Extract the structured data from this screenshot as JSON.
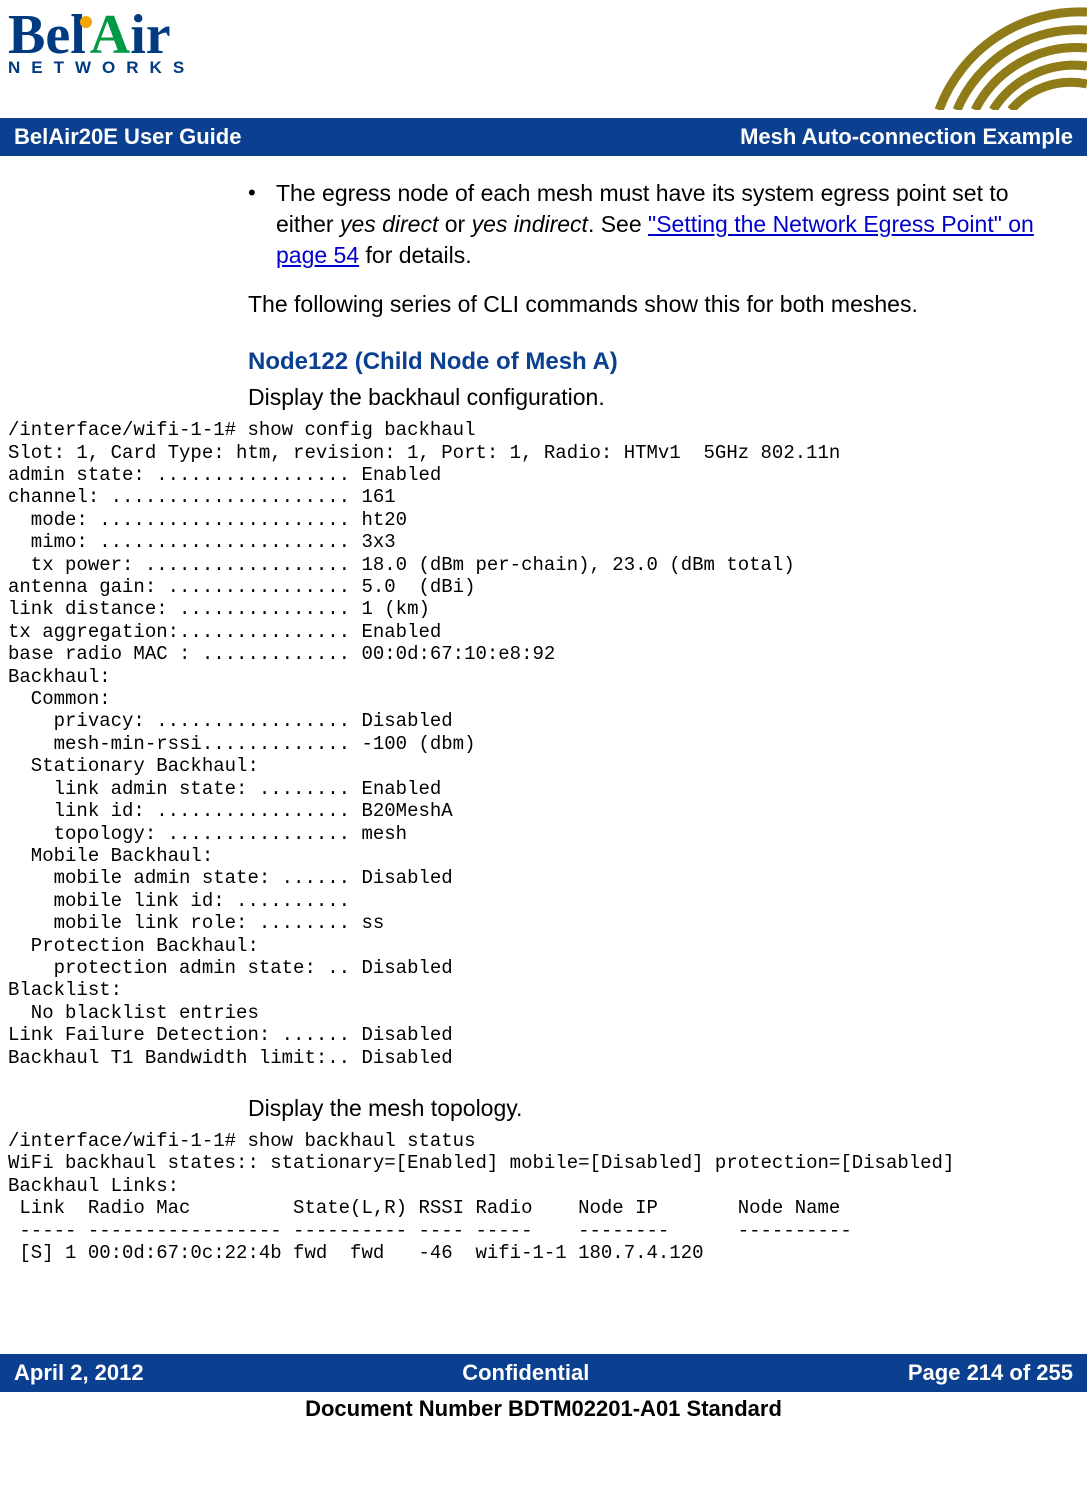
{
  "logo": {
    "bel": "Bel",
    "a": "A",
    "ir": "ir",
    "networks": "NETWORKS"
  },
  "header": {
    "left": "BelAir20E User Guide",
    "right": "Mesh Auto-connection Example"
  },
  "bullet1": {
    "pre": "The egress node of each mesh must have its system egress point set to either ",
    "i1": "yes direct",
    "mid": " or ",
    "i2": "yes indirect",
    "postdot": ". See ",
    "link": "\"Setting the Network Egress Point\" on page 54",
    "tail": " for details."
  },
  "para1": "The following series of CLI commands show this for both meshes.",
  "h3a": "Node122 (Child Node of Mesh A)",
  "sub1": "Display the backhaul configuration.",
  "cli1": "/interface/wifi-1-1# show config backhaul\nSlot: 1, Card Type: htm, revision: 1, Port: 1, Radio: HTMv1  5GHz 802.11n\nadmin state: ................. Enabled\nchannel: ..................... 161\n  mode: ...................... ht20\n  mimo: ...................... 3x3\n  tx power: .................. 18.0 (dBm per-chain), 23.0 (dBm total)\nantenna gain: ................ 5.0  (dBi)\nlink distance: ............... 1 (km)\ntx aggregation:............... Enabled\nbase radio MAC : ............. 00:0d:67:10:e8:92\nBackhaul:\n  Common:\n    privacy: ................. Disabled\n    mesh-min-rssi............. -100 (dbm)\n  Stationary Backhaul:\n    link admin state: ........ Enabled\n    link id: ................. B20MeshA\n    topology: ................ mesh\n  Mobile Backhaul:\n    mobile admin state: ...... Disabled\n    mobile link id: ..........\n    mobile link role: ........ ss\n  Protection Backhaul:\n    protection admin state: .. Disabled\nBlacklist:\n  No blacklist entries\nLink Failure Detection: ...... Disabled\nBackhaul T1 Bandwidth limit:.. Disabled",
  "sub2": "Display the mesh topology.",
  "cli2": "/interface/wifi-1-1# show backhaul status\nWiFi backhaul states:: stationary=[Enabled] mobile=[Disabled] protection=[Disabled]\nBackhaul Links:\n Link  Radio Mac         State(L,R) RSSI Radio    Node IP       Node Name\n ----- ----------------- ---------- ---- -----    --------      ----------\n [S] 1 00:0d:67:0c:22:4b fwd  fwd   -46  wifi-1-1 180.7.4.120",
  "footer": {
    "date": "April 2, 2012",
    "center": "Confidential",
    "page": "Page 214 of 255",
    "docnum": "Document Number BDTM02201-A01 Standard"
  }
}
